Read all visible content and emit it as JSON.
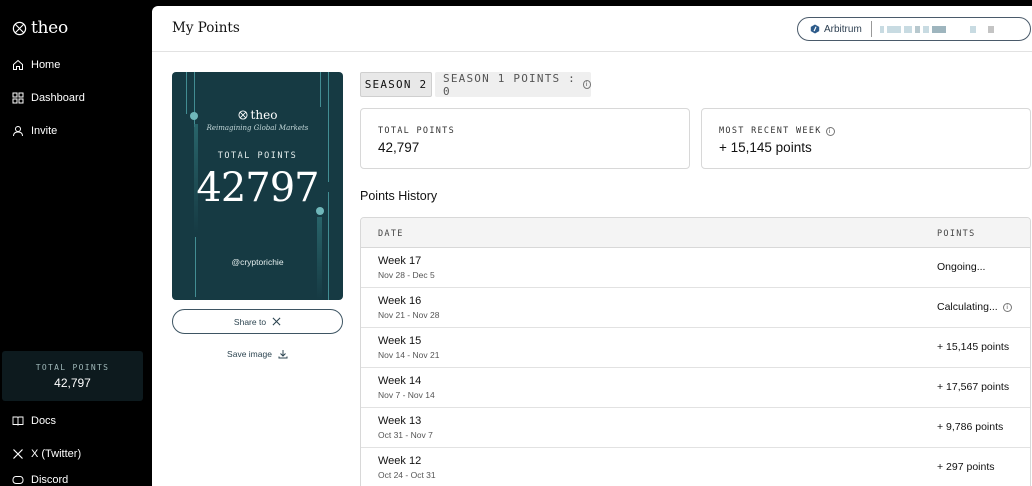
{
  "sidebar": {
    "brand": "theo",
    "nav": [
      {
        "label": "Home",
        "icon": "home-icon"
      },
      {
        "label": "Dashboard",
        "icon": "dashboard-icon"
      },
      {
        "label": "Invite",
        "icon": "user-icon"
      }
    ],
    "total_points_label": "TOTAL POINTS",
    "total_points_value": "42,797",
    "footer": [
      {
        "label": "Docs",
        "icon": "book-icon"
      },
      {
        "label": "X (Twitter)",
        "icon": "x-logo-icon"
      },
      {
        "label": "Discord",
        "icon": "discord-icon"
      }
    ]
  },
  "header": {
    "title": "My Points",
    "network": "Arbitrum",
    "network_icon": "arbitrum-icon"
  },
  "share_card": {
    "brand": "theo",
    "tagline": "Reimagining Global Markets",
    "label": "TOTAL POINTS",
    "value": "42797",
    "handle": "@cryptorichie",
    "share_label": "Share to",
    "save_label": "Save image"
  },
  "tabs": {
    "active": "SEASON 2",
    "inactive": "SEASON 1 POINTS : 0"
  },
  "stats": {
    "total_label": "TOTAL POINTS",
    "total_value": "42,797",
    "recent_label": "MOST RECENT WEEK",
    "recent_value": "+ 15,145 points"
  },
  "history": {
    "title": "Points History",
    "col_date": "DATE",
    "col_points": "POINTS",
    "rows": [
      {
        "week": "Week 17",
        "range": "Nov 28 - Dec 5",
        "points": "Ongoing..."
      },
      {
        "week": "Week 16",
        "range": "Nov 21 - Nov 28",
        "points": "Calculating..."
      },
      {
        "week": "Week 15",
        "range": "Nov 14 - Nov 21",
        "points": "+ 15,145 points"
      },
      {
        "week": "Week 14",
        "range": "Nov 7 - Nov 14",
        "points": "+ 17,567 points"
      },
      {
        "week": "Week 13",
        "range": "Oct 31 - Nov 7",
        "points": "+ 9,786 points"
      },
      {
        "week": "Week 12",
        "range": "Oct 24 - Oct 31",
        "points": "+ 297 points"
      }
    ]
  },
  "colors": {
    "card_bg": "#163a43",
    "sidebar_bg": "#000000",
    "accent": "#4ea3a8"
  }
}
